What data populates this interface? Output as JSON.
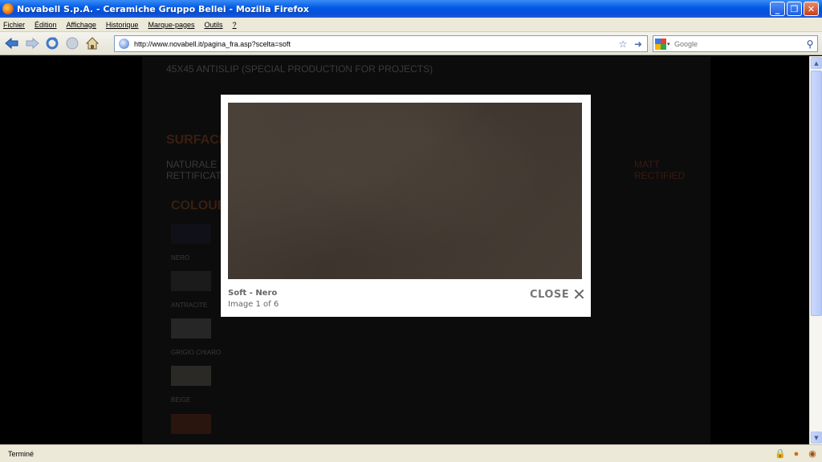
{
  "window": {
    "title": "Novabell S.p.A. - Ceramiche Gruppo Bellei - Mozilla Firefox",
    "minimize_glyph": "_",
    "maximize_glyph": "❐",
    "close_glyph": "✕"
  },
  "menubar": {
    "items": [
      "Fichier",
      "Édition",
      "Affichage",
      "Historique",
      "Marque-pages",
      "Outils",
      "?"
    ]
  },
  "navbar": {
    "url": "http://www.novabell.it/pagina_fra.asp?scelta=soft",
    "search_placeholder": "Google"
  },
  "page": {
    "heading_size": "45X45 ANTISLIP (SPECIAL PRODUCTION FOR PROJECTS)",
    "heading_surface": "SURFACE",
    "surface_left_1": "NATURALE",
    "surface_left_2": "RETTIFICATO",
    "surface_right_1": "MATT",
    "surface_right_2": "RECTIFIED",
    "heading_colours": "COLOURS",
    "colours": [
      {
        "label": "NERO",
        "color": "#101018"
      },
      {
        "label": "ANTRACITE",
        "color": "#1b1b1b"
      },
      {
        "label": "GRIGIO CHIARO",
        "color": "#262626"
      },
      {
        "label": "BEIGE",
        "color": "#2b2925"
      },
      {
        "label": "",
        "color": "#2a150e"
      }
    ]
  },
  "lightbox": {
    "title": "Soft - Nero",
    "count": "Image 1 of 6",
    "close_label": "CLOSE",
    "close_glyph": "✕"
  },
  "statusbar": {
    "text": "Terminé"
  }
}
